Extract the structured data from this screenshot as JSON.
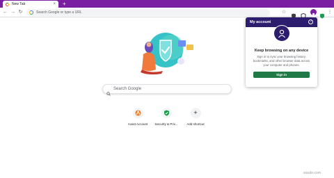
{
  "browser": {
    "tab_title": "New Tab",
    "tab_close": "×",
    "new_tab": "+",
    "back": "←",
    "forward": "→",
    "reload": "↻",
    "omnibox_placeholder": "Search Google or type a URL",
    "star": "☆",
    "menu": "⋮",
    "accent": "#7b1fa2"
  },
  "ntp": {
    "search_placeholder": "Search Google",
    "shortcuts": [
      {
        "label": "Avast Account",
        "icon": "avast-icon"
      },
      {
        "label": "Security & Priv...",
        "icon": "shield-check-icon"
      },
      {
        "label": "Add shortcut",
        "icon": "plus-icon",
        "glyph": "+"
      }
    ]
  },
  "popup": {
    "title": "My account",
    "help": "?",
    "heading": "Keep browsing on any device",
    "body": "Sign in to sync your browsing history, bookmarks, and other browser data across your computer and phones.",
    "signin": "Sign in",
    "header_color": "#2d1d6e",
    "button_color": "#1f7a45"
  },
  "watermark": "wsxdn.com"
}
